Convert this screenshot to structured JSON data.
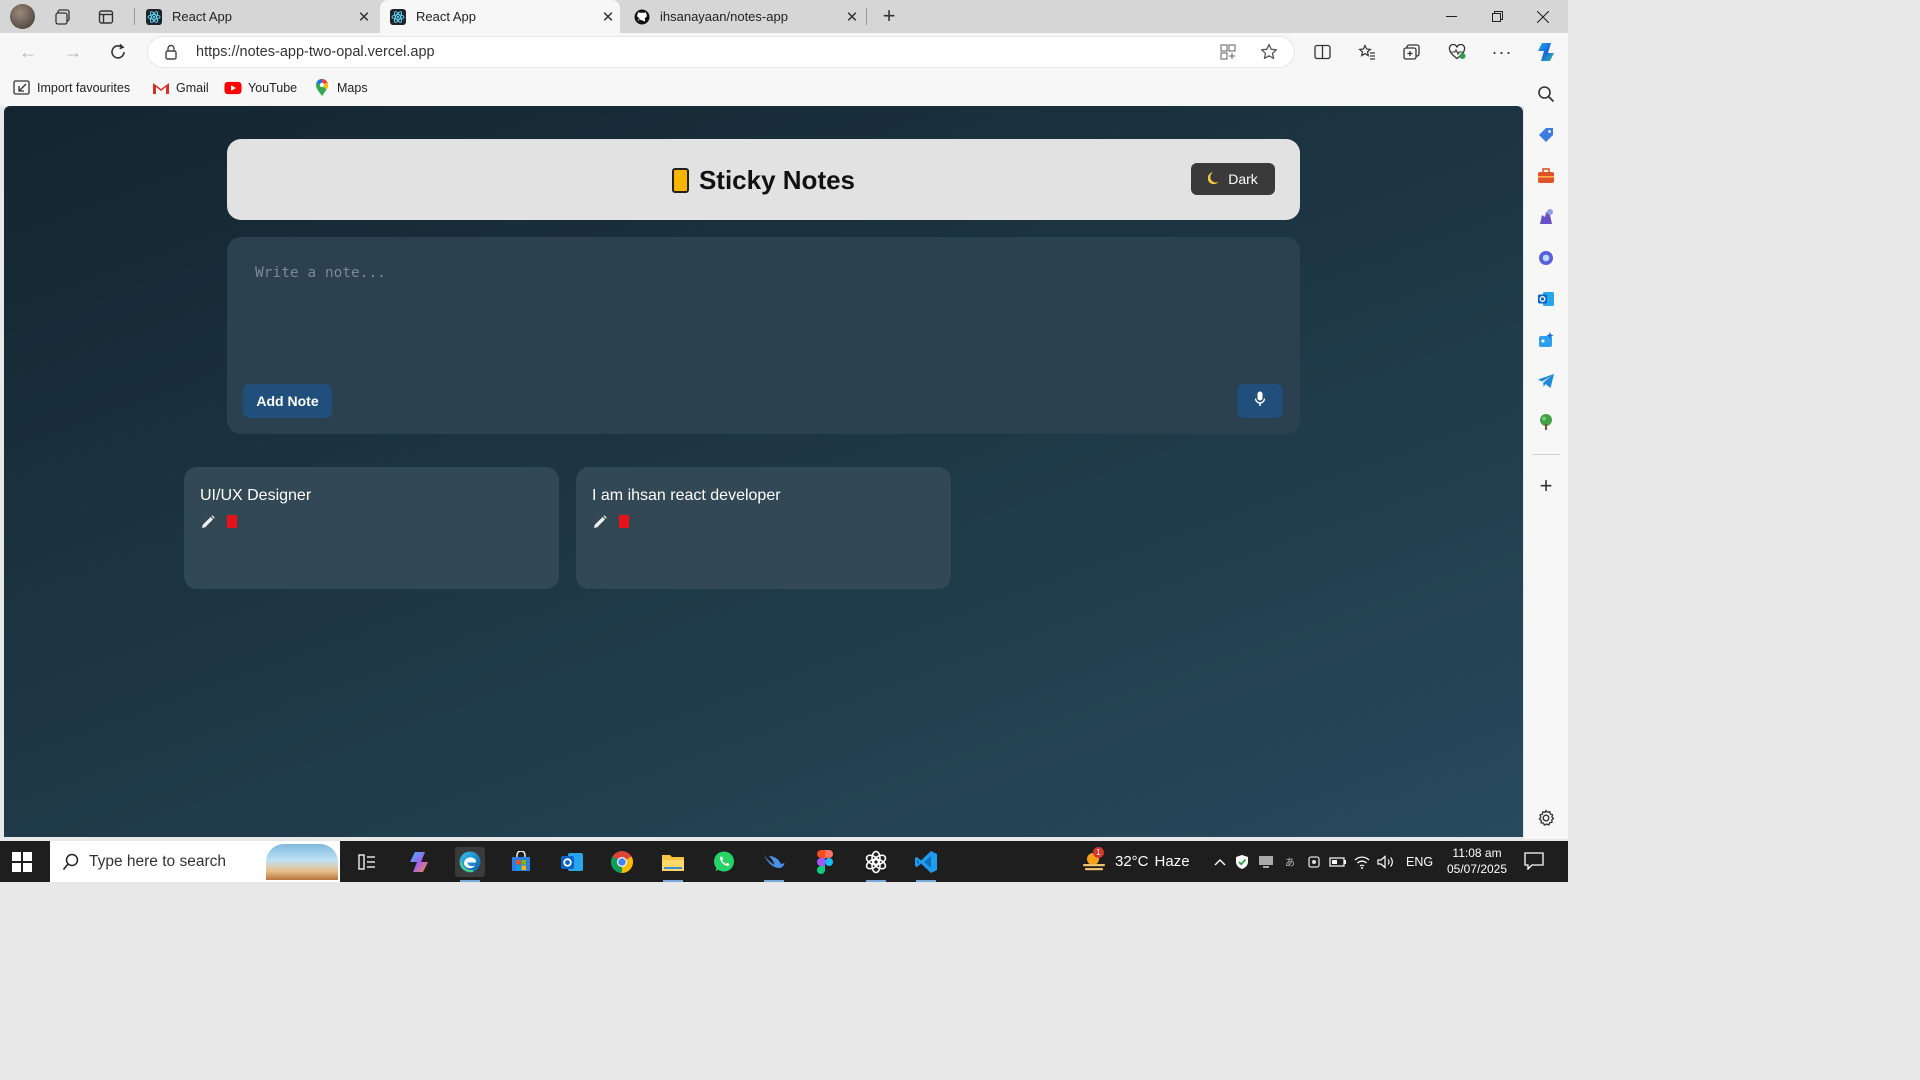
{
  "browser": {
    "tabs": [
      {
        "title": "React App",
        "active": false,
        "icon": "react-icon"
      },
      {
        "title": "React App",
        "active": true,
        "icon": "react-icon"
      },
      {
        "title": "ihsanayaan/notes-app",
        "active": false,
        "icon": "github-icon"
      }
    ],
    "url": "https://notes-app-two-opal.vercel.app",
    "favourites": [
      {
        "label": "Import favourites",
        "icon": "import-icon"
      },
      {
        "label": "Gmail",
        "icon": "gmail-icon"
      },
      {
        "label": "YouTube",
        "icon": "youtube-icon"
      },
      {
        "label": "Maps",
        "icon": "maps-icon"
      }
    ],
    "sidebar_icons": [
      "search-icon",
      "shopping-tag-icon",
      "toolbox-icon",
      "games-icon",
      "copilot-icon",
      "outlook-icon",
      "designer-icon",
      "telegram-icon",
      "tree-icon",
      "add-icon",
      "settings-icon"
    ]
  },
  "app": {
    "title": "Sticky Notes",
    "theme_toggle": {
      "icon": "moon-icon",
      "label": "Dark"
    },
    "composer": {
      "placeholder": "Write a note...",
      "value": "",
      "add_button": "Add Note",
      "mic_icon": "microphone-icon"
    },
    "notes": [
      {
        "text": "UI/UX Designer"
      },
      {
        "text": "I am ihsan react developer"
      }
    ],
    "colors": {
      "header_bg": "#e2e2e2",
      "button": "#1f4f7a",
      "delete": "#e8101a",
      "card": "#324855"
    }
  },
  "taskbar": {
    "search_placeholder": "Type here to search",
    "weather": {
      "temp": "32°C",
      "condition": "Haze",
      "badge": "1"
    },
    "language": "ENG",
    "time": "11:08 am",
    "date": "05/07/2025",
    "pinned": [
      "task-view-icon",
      "copilot-icon",
      "edge-icon",
      "store-icon",
      "outlook-icon",
      "chrome-icon",
      "file-explorer-icon",
      "whatsapp-icon",
      "bird-app-icon",
      "figma-icon",
      "chatgpt-icon",
      "vscode-icon"
    ]
  }
}
